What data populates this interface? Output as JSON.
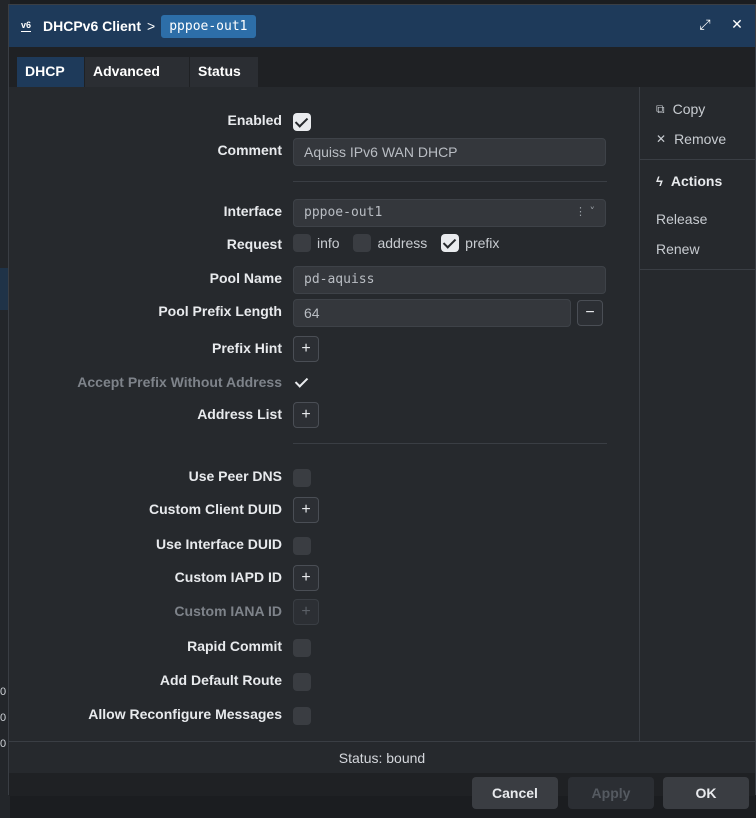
{
  "titlebar": {
    "icon_label": "v6",
    "title": "DHCPv6 Client",
    "separator": ">",
    "breadcrumb": "pppoe-out1",
    "expand_glyph": "⤢",
    "close_glyph": "✕"
  },
  "tabs": [
    {
      "label": "DHCP",
      "active": true
    },
    {
      "label": "Advanced",
      "active": false
    },
    {
      "label": "Status",
      "active": false
    }
  ],
  "form": {
    "enabled": {
      "label": "Enabled",
      "checked": true
    },
    "comment": {
      "label": "Comment",
      "value": "Aquiss IPv6 WAN DHCP"
    },
    "interface": {
      "label": "Interface",
      "value": "pppoe-out1"
    },
    "request": {
      "label": "Request",
      "options": [
        {
          "label": "info",
          "checked": false
        },
        {
          "label": "address",
          "checked": false
        },
        {
          "label": "prefix",
          "checked": true
        }
      ]
    },
    "pool_name": {
      "label": "Pool Name",
      "value": "pd-aquiss"
    },
    "pool_prefix_length": {
      "label": "Pool Prefix Length",
      "value": "64"
    },
    "prefix_hint": {
      "label": "Prefix Hint"
    },
    "accept_prefix": {
      "label": "Accept Prefix Without Address",
      "checked": true
    },
    "address_list": {
      "label": "Address List"
    },
    "use_peer_dns": {
      "label": "Use Peer DNS",
      "checked": false
    },
    "custom_client_duid": {
      "label": "Custom Client DUID"
    },
    "use_interface_duid": {
      "label": "Use Interface DUID",
      "checked": false
    },
    "custom_iapd_id": {
      "label": "Custom IAPD ID"
    },
    "custom_iana_id": {
      "label": "Custom IANA ID"
    },
    "rapid_commit": {
      "label": "Rapid Commit",
      "checked": false
    },
    "add_default_route": {
      "label": "Add Default Route",
      "checked": false
    },
    "allow_reconfigure": {
      "label": "Allow Reconfigure Messages",
      "checked": false
    }
  },
  "sidebar": {
    "copy": "Copy",
    "remove": "Remove",
    "actions_heading": "Actions",
    "release": "Release",
    "renew": "Renew"
  },
  "status": "Status: bound",
  "footer": {
    "cancel": "Cancel",
    "apply": "Apply",
    "ok": "OK"
  },
  "behind_digits": [
    "0",
    "0",
    "0"
  ],
  "colors": {
    "titlebar": "#1e3a5a",
    "accent": "#2d6ea8",
    "panel": "#26292d"
  }
}
